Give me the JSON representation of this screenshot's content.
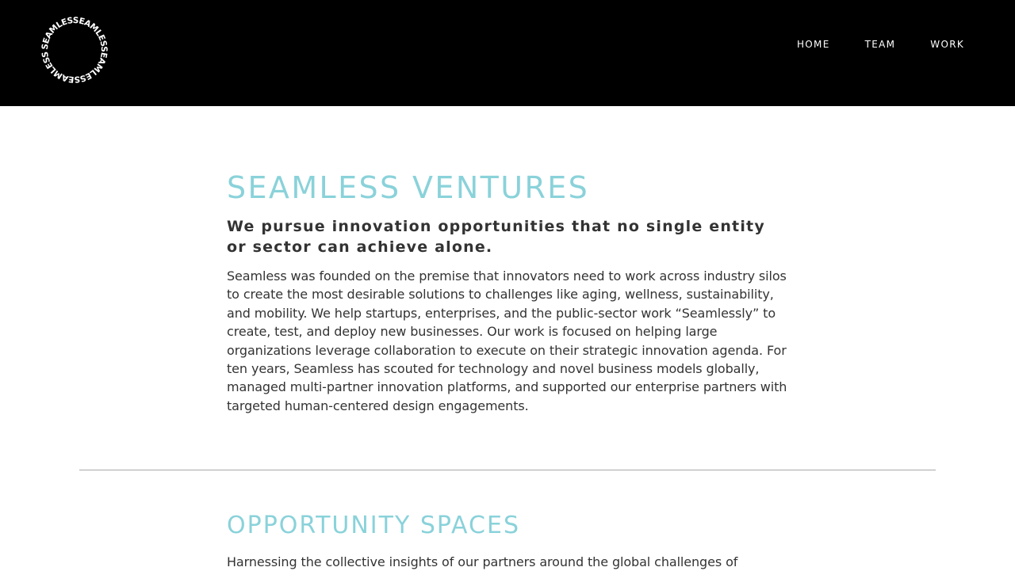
{
  "header": {
    "logo": {
      "text": "SEAMLESSEAMLESSEAMLESSEAMLESS",
      "icon": "circular-seamless-wordmark",
      "color": "#ffffff"
    },
    "nav": {
      "home": "HOME",
      "team": "TEAM",
      "work": "WORK"
    },
    "background": "#000000"
  },
  "hero": {
    "title": "SEAMLESS VENTURES",
    "subtitle": "We pursue innovation opportunities that no single entity or sector can achieve alone.",
    "body": "Seamless was founded on the premise that innovators need to work across industry silos to create the most desirable solutions to challenges like aging, wellness, sustainability, and mobility.  We help startups, enterprises, and the public-sector work “Seamlessly” to create, test, and deploy new businesses. Our work is focused on helping large organizations leverage collaboration to execute on their strategic innovation agenda. For ten years, Seamless has scouted for technology and novel business models globally, managed multi-partner innovation platforms, and supported our enterprise partners with targeted human-centered design engagements."
  },
  "opportunity": {
    "title": "OPPORTUNITY SPACES",
    "body": "Harnessing the collective insights of our partners around the global challenges of"
  },
  "colors": {
    "accent": "#8ad2da",
    "text": "#333333",
    "divider": "#a8a8a8"
  }
}
